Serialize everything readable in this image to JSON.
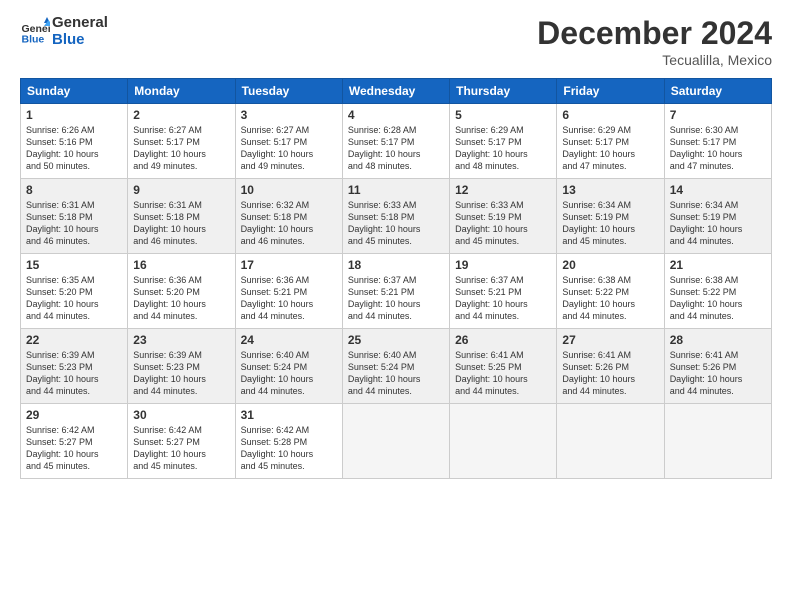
{
  "logo": {
    "text_general": "General",
    "text_blue": "Blue"
  },
  "title": "December 2024",
  "location": "Tecualilla, Mexico",
  "headers": [
    "Sunday",
    "Monday",
    "Tuesday",
    "Wednesday",
    "Thursday",
    "Friday",
    "Saturday"
  ],
  "weeks": [
    [
      {
        "day": "1",
        "sunrise": "6:26 AM",
        "sunset": "5:16 PM",
        "daylight": "10 hours and 50 minutes."
      },
      {
        "day": "2",
        "sunrise": "6:27 AM",
        "sunset": "5:17 PM",
        "daylight": "10 hours and 49 minutes."
      },
      {
        "day": "3",
        "sunrise": "6:27 AM",
        "sunset": "5:17 PM",
        "daylight": "10 hours and 49 minutes."
      },
      {
        "day": "4",
        "sunrise": "6:28 AM",
        "sunset": "5:17 PM",
        "daylight": "10 hours and 48 minutes."
      },
      {
        "day": "5",
        "sunrise": "6:29 AM",
        "sunset": "5:17 PM",
        "daylight": "10 hours and 48 minutes."
      },
      {
        "day": "6",
        "sunrise": "6:29 AM",
        "sunset": "5:17 PM",
        "daylight": "10 hours and 47 minutes."
      },
      {
        "day": "7",
        "sunrise": "6:30 AM",
        "sunset": "5:17 PM",
        "daylight": "10 hours and 47 minutes."
      }
    ],
    [
      {
        "day": "8",
        "sunrise": "6:31 AM",
        "sunset": "5:18 PM",
        "daylight": "10 hours and 46 minutes."
      },
      {
        "day": "9",
        "sunrise": "6:31 AM",
        "sunset": "5:18 PM",
        "daylight": "10 hours and 46 minutes."
      },
      {
        "day": "10",
        "sunrise": "6:32 AM",
        "sunset": "5:18 PM",
        "daylight": "10 hours and 46 minutes."
      },
      {
        "day": "11",
        "sunrise": "6:33 AM",
        "sunset": "5:18 PM",
        "daylight": "10 hours and 45 minutes."
      },
      {
        "day": "12",
        "sunrise": "6:33 AM",
        "sunset": "5:19 PM",
        "daylight": "10 hours and 45 minutes."
      },
      {
        "day": "13",
        "sunrise": "6:34 AM",
        "sunset": "5:19 PM",
        "daylight": "10 hours and 45 minutes."
      },
      {
        "day": "14",
        "sunrise": "6:34 AM",
        "sunset": "5:19 PM",
        "daylight": "10 hours and 44 minutes."
      }
    ],
    [
      {
        "day": "15",
        "sunrise": "6:35 AM",
        "sunset": "5:20 PM",
        "daylight": "10 hours and 44 minutes."
      },
      {
        "day": "16",
        "sunrise": "6:36 AM",
        "sunset": "5:20 PM",
        "daylight": "10 hours and 44 minutes."
      },
      {
        "day": "17",
        "sunrise": "6:36 AM",
        "sunset": "5:21 PM",
        "daylight": "10 hours and 44 minutes."
      },
      {
        "day": "18",
        "sunrise": "6:37 AM",
        "sunset": "5:21 PM",
        "daylight": "10 hours and 44 minutes."
      },
      {
        "day": "19",
        "sunrise": "6:37 AM",
        "sunset": "5:21 PM",
        "daylight": "10 hours and 44 minutes."
      },
      {
        "day": "20",
        "sunrise": "6:38 AM",
        "sunset": "5:22 PM",
        "daylight": "10 hours and 44 minutes."
      },
      {
        "day": "21",
        "sunrise": "6:38 AM",
        "sunset": "5:22 PM",
        "daylight": "10 hours and 44 minutes."
      }
    ],
    [
      {
        "day": "22",
        "sunrise": "6:39 AM",
        "sunset": "5:23 PM",
        "daylight": "10 hours and 44 minutes."
      },
      {
        "day": "23",
        "sunrise": "6:39 AM",
        "sunset": "5:23 PM",
        "daylight": "10 hours and 44 minutes."
      },
      {
        "day": "24",
        "sunrise": "6:40 AM",
        "sunset": "5:24 PM",
        "daylight": "10 hours and 44 minutes."
      },
      {
        "day": "25",
        "sunrise": "6:40 AM",
        "sunset": "5:24 PM",
        "daylight": "10 hours and 44 minutes."
      },
      {
        "day": "26",
        "sunrise": "6:41 AM",
        "sunset": "5:25 PM",
        "daylight": "10 hours and 44 minutes."
      },
      {
        "day": "27",
        "sunrise": "6:41 AM",
        "sunset": "5:26 PM",
        "daylight": "10 hours and 44 minutes."
      },
      {
        "day": "28",
        "sunrise": "6:41 AM",
        "sunset": "5:26 PM",
        "daylight": "10 hours and 44 minutes."
      }
    ],
    [
      {
        "day": "29",
        "sunrise": "6:42 AM",
        "sunset": "5:27 PM",
        "daylight": "10 hours and 45 minutes."
      },
      {
        "day": "30",
        "sunrise": "6:42 AM",
        "sunset": "5:27 PM",
        "daylight": "10 hours and 45 minutes."
      },
      {
        "day": "31",
        "sunrise": "6:42 AM",
        "sunset": "5:28 PM",
        "daylight": "10 hours and 45 minutes."
      },
      null,
      null,
      null,
      null
    ]
  ],
  "labels": {
    "sunrise": "Sunrise: ",
    "sunset": "Sunset: ",
    "daylight": "Daylight: "
  }
}
